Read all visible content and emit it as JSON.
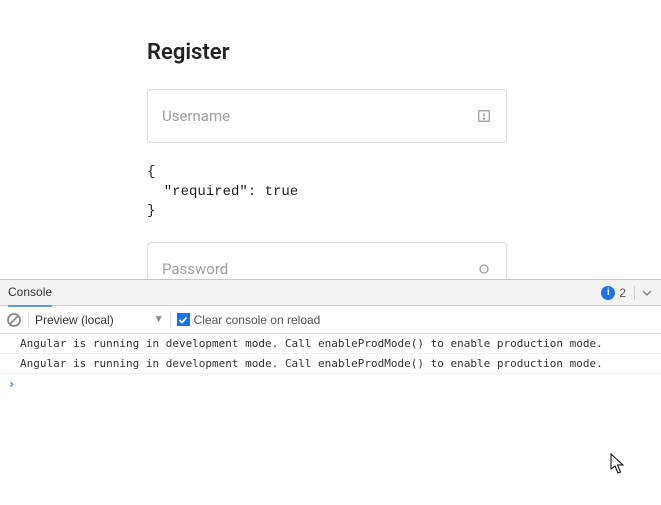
{
  "form": {
    "title": "Register",
    "username": {
      "placeholder": "Username"
    },
    "password": {
      "placeholder": "Password"
    },
    "validation_json": "{\n  \"required\": true\n}"
  },
  "devtools": {
    "tab": "Console",
    "info_count": "2",
    "source": "Preview (local)",
    "clear_on_reload_label": "Clear console on reload",
    "logs": [
      "Angular is running in development mode. Call enableProdMode() to enable production mode.",
      "Angular is running in development mode. Call enableProdMode() to enable production mode."
    ]
  }
}
